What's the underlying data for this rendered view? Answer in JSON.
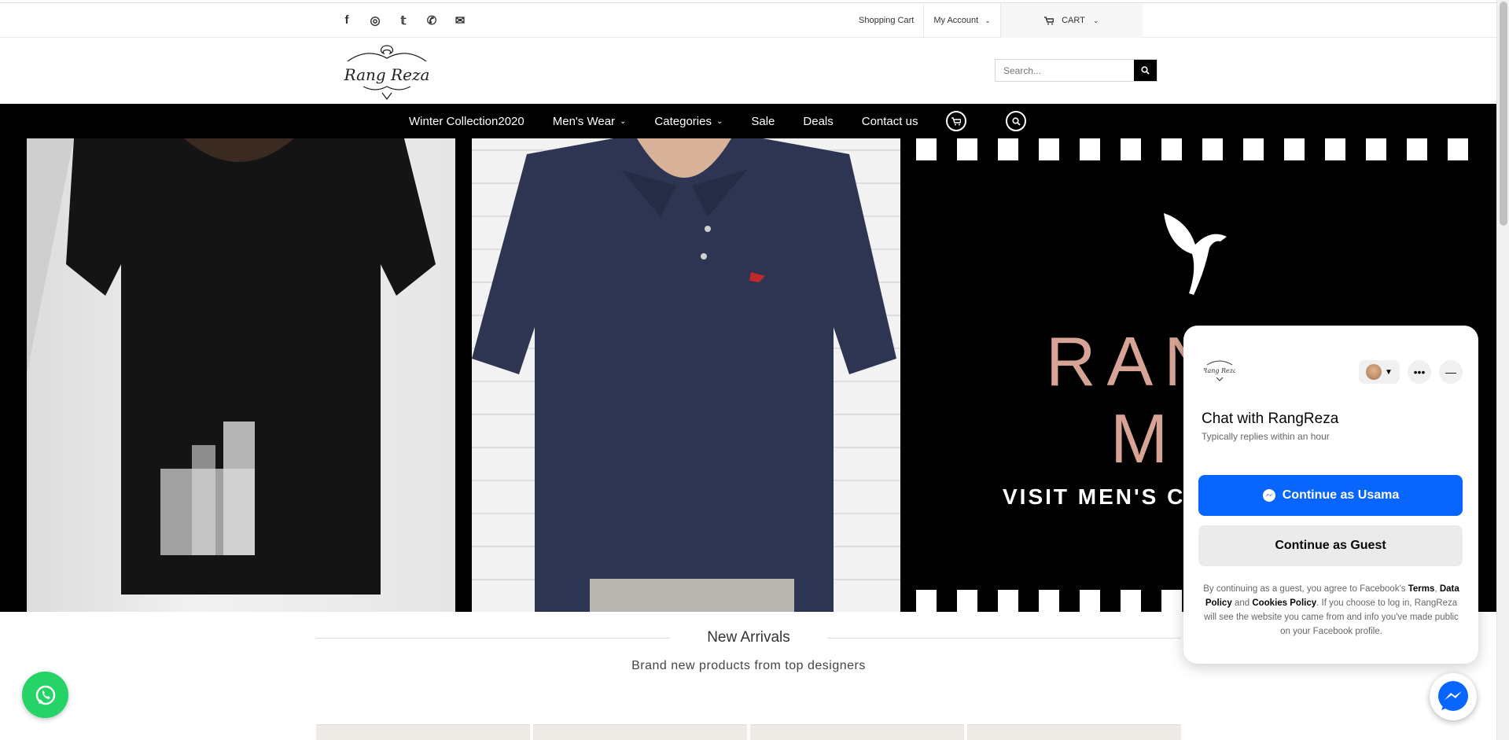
{
  "topbar": {
    "socials": [
      {
        "icon": "facebook-icon",
        "glyph": "f"
      },
      {
        "icon": "instagram-icon",
        "glyph": "◎"
      },
      {
        "icon": "twitter-icon",
        "glyph": "𝕥"
      },
      {
        "icon": "whatsapp-icon",
        "glyph": "✆"
      },
      {
        "icon": "mail-icon",
        "glyph": "✉"
      }
    ],
    "shopping_cart": "Shopping Cart",
    "my_account": "My Account",
    "cart": "CART"
  },
  "header": {
    "logo_text": "Rang Reza",
    "search_placeholder": "Search..."
  },
  "nav": {
    "items": [
      "Winter Collection2020",
      "Men's Wear",
      "Categories",
      "Sale",
      "Deals",
      "Contact us"
    ]
  },
  "hero": {
    "brand_line1": "RANG",
    "brand_line2": "ME",
    "visit": "VISIT MEN'S CO"
  },
  "section": {
    "title": "New Arrivals",
    "subtitle": "Brand new products from top designers"
  },
  "chat": {
    "title": "Chat with RangReza",
    "reply_time": "Typically replies within an hour",
    "continue_user": "Continue as Usama",
    "continue_guest": "Continue as Guest",
    "legal_1": "By continuing as a guest, you agree to Facebook's",
    "legal_terms": "Terms",
    "legal_comma": ",",
    "legal_data": "Data Policy",
    "legal_and": "and",
    "legal_cookies": "Cookies Policy",
    "legal_2": ". If you choose to log in, RangReza will see the website you came from and info you've made public on your Facebook profile."
  },
  "colors": {
    "nav_bg": "#000000",
    "messenger_blue": "#0866ff",
    "whatsapp_green": "#25d366",
    "hero_brand": "#d7a394"
  }
}
